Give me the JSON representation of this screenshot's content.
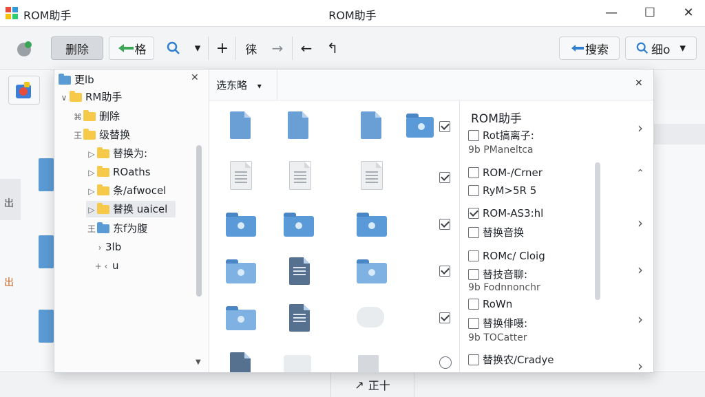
{
  "window": {
    "title_left": "ROM助手",
    "title_center": "ROM助手",
    "minimize": "—",
    "maximize": "☐",
    "close": "✕"
  },
  "toolbar": {
    "delete_label": "删除",
    "back_label": "格",
    "search_glyph": "🔍",
    "dropdown_glyph": "▾",
    "add_glyph": "+",
    "mid_label": "徕",
    "forward_glyph": "→",
    "left_glyph": "←",
    "corner_glyph": "↰",
    "search_label": "搜索",
    "detail_label": "细o",
    "detail_dropdown": "▾"
  },
  "tree": {
    "header_label": "更lb",
    "header_close": "✕",
    "items": [
      {
        "expander": "∨",
        "label": "RM助手"
      },
      {
        "expander": "⌘",
        "label": "删除"
      },
      {
        "expander": "王",
        "label": "级替换"
      },
      {
        "expander": "▷",
        "label": "替换为:"
      },
      {
        "expander": "▷",
        "label": "ROaths"
      },
      {
        "expander": "▷",
        "label": "条/afwocel"
      },
      {
        "expander": "▷",
        "label": "替换 uaicel"
      },
      {
        "expander": "王",
        "label": "东f为腹"
      },
      {
        "expander": "›",
        "label": "3lb"
      },
      {
        "expander": "+ ‹",
        "label": "u"
      }
    ]
  },
  "pane": {
    "filter_label": "选东略",
    "filter_dropdown": "▾",
    "close": "✕"
  },
  "list": {
    "title": "ROM助手",
    "items": [
      {
        "type": "check",
        "checked": false,
        "label": "Rot搞离子:"
      },
      {
        "type": "sub",
        "label": "9b PManeltca"
      },
      {
        "type": "check",
        "checked": false,
        "label": "ROM-/Crner"
      },
      {
        "type": "check",
        "checked": false,
        "label": "RyM>5R 5"
      },
      {
        "type": "check",
        "checked": true,
        "label": "ROM-AS3:hl"
      },
      {
        "type": "check",
        "checked": false,
        "label": "替换音换"
      },
      {
        "type": "check",
        "checked": false,
        "label": "ROMc/ Cloig"
      },
      {
        "type": "check",
        "checked": false,
        "label": "替技音聊:"
      },
      {
        "type": "sub",
        "label": "9b Fodnnonchr"
      },
      {
        "type": "check",
        "checked": false,
        "label": "RoWn"
      },
      {
        "type": "check",
        "checked": false,
        "label": "替换俳嗫:"
      },
      {
        "type": "sub",
        "label": "9b TOCatter"
      },
      {
        "type": "check",
        "checked": false,
        "label": "替换农/Cradye"
      }
    ],
    "arrows": [
      "›",
      "⌃",
      "›",
      "›",
      "›",
      "›"
    ]
  },
  "status": {
    "label": "正十",
    "icon": "↗"
  },
  "side_labels": [
    "出",
    "出"
  ],
  "colors": {
    "folder_yellow": "#f7c948",
    "file_blue": "#6a9fd6",
    "accent_green": "#3aa655"
  }
}
